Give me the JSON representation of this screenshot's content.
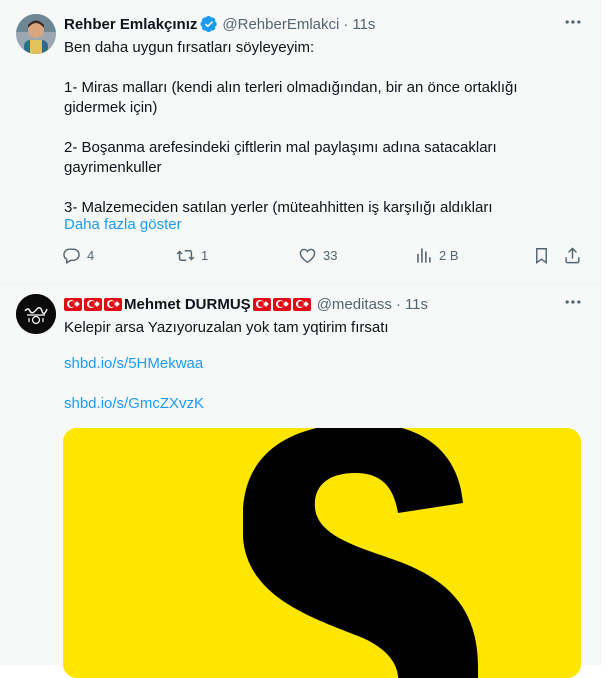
{
  "tweets": [
    {
      "name": "Rehber Emlakçınız",
      "handle": "@RehberEmlakci",
      "separator": "·",
      "time": "11s",
      "text_lines": [
        "Ben daha uygun fırsatları söyleyeyim:",
        "",
        "1- Miras malları (kendi alın terleri olmadığından, bir an önce ortaklığı",
        "gidermek için)",
        "",
        "2- Boşanma arefesindeki çiftlerin mal paylaşımı adına satacakları",
        "gayrimenkuller",
        "",
        "3- Malzemeciden satılan yerler (müteahhitten iş karşılığı aldıkları"
      ],
      "show_more": "Daha fazla göster",
      "replies": "4",
      "retweets": "1",
      "likes": "33",
      "views": "2 B"
    },
    {
      "name": "Mehmet DURMUŞ",
      "handle": "@meditass",
      "separator": "·",
      "time": "11s",
      "text": "Kelepir arsa Yazıyoruzalan yok tam yqtirim fırsatı",
      "links": [
        "shbd.io/s/5HMekwaa",
        "shbd.io/s/GmcZXvzK"
      ],
      "media_letter": "S"
    }
  ],
  "colors": {
    "accent": "#1d9bf0",
    "secondary_text": "#536471",
    "media_bg": "#ffe600",
    "flag_red": "#e30a17"
  },
  "icons": [
    "verified-badge-icon",
    "more-icon",
    "reply-icon",
    "retweet-icon",
    "like-icon",
    "views-icon",
    "bookmark-icon",
    "share-icon",
    "turkish-flag-icon"
  ]
}
